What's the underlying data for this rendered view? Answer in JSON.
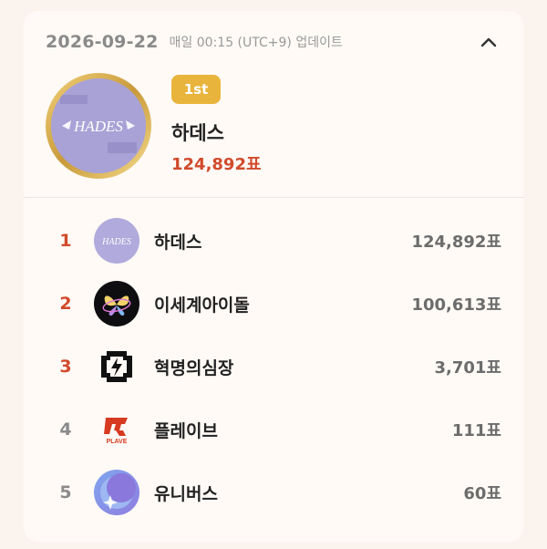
{
  "header": {
    "date": "2026-09-22",
    "update_note": "매일 00:15 (UTC+9) 업데이트"
  },
  "winner": {
    "badge": "1st",
    "name": "하데스",
    "votes": "124,892표",
    "logo_text": "HADES"
  },
  "ranking": [
    {
      "rank": "1",
      "name": "하데스",
      "votes": "124,892표",
      "logo_text": "HADES",
      "rank_color": "#d14a2c"
    },
    {
      "rank": "2",
      "name": "이세계아이돌",
      "votes": "100,613표",
      "rank_color": "#d14a2c"
    },
    {
      "rank": "3",
      "name": "혁명의심장",
      "votes": "3,701표",
      "rank_color": "#d14a2c"
    },
    {
      "rank": "4",
      "name": "플레이브",
      "votes": "111표",
      "logo_text": "PLAVE",
      "rank_color": "#8a8a8a"
    },
    {
      "rank": "5",
      "name": "유니버스",
      "votes": "60표",
      "rank_color": "#8a8a8a"
    }
  ],
  "colors": {
    "accent": "#d14a2c",
    "badge": "#e9b43c",
    "card_bg": "#fffaf6"
  },
  "icons": {
    "collapse": "chevron-up-icon"
  }
}
